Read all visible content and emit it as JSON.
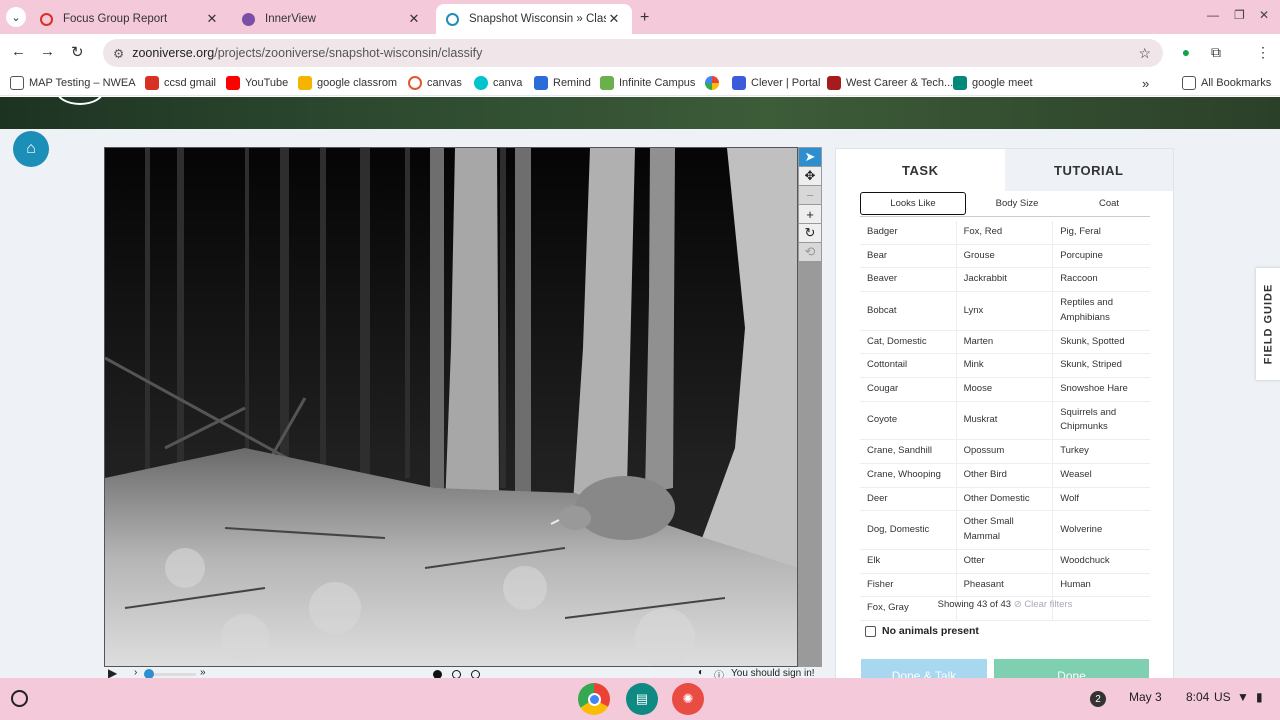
{
  "browser": {
    "tabs": [
      {
        "title": "Focus Group Report",
        "fav_color": "#d93025"
      },
      {
        "title": "InnerView",
        "fav_color": "#7b4fa5"
      },
      {
        "title": "Snapshot Wisconsin » Classify",
        "fav_color": "#1b8fb7"
      }
    ],
    "url_domain": "zooniverse.org",
    "url_path": "/projects/zooniverse/snapshot-wisconsin/classify",
    "bookmarks": [
      {
        "label": "MAP Testing – NWEA",
        "color": "#555555"
      },
      {
        "label": "ccsd gmail",
        "color": "#d93025"
      },
      {
        "label": "YouTube",
        "color": "#ff0000"
      },
      {
        "label": "google classrom",
        "color": "#f4b400"
      },
      {
        "label": "canvas",
        "color": "#e4572e"
      },
      {
        "label": "canva",
        "color": "#00c4cc"
      },
      {
        "label": "Remind",
        "color": "#2b6cd9"
      },
      {
        "label": "Infinite Campus",
        "color": "#6ab04c"
      },
      {
        "label": "",
        "color": "#4285f4"
      },
      {
        "label": "Clever | Portal",
        "color": "#3b5bdb"
      },
      {
        "label": "West Career & Tech...",
        "color": "#a61c1c"
      },
      {
        "label": "google meet",
        "color": "#00897b"
      }
    ],
    "all_bookmarks": "All Bookmarks"
  },
  "viewer": {
    "indicator": "You should sign in!"
  },
  "panel": {
    "tabs": [
      "TASK",
      "TUTORIAL"
    ],
    "filters": [
      "Looks Like",
      "Body Size",
      "Coat"
    ],
    "species_rows": [
      [
        "Badger",
        "Fox, Red",
        "Pig, Feral"
      ],
      [
        "Bear",
        "Grouse",
        "Porcupine"
      ],
      [
        "Beaver",
        "Jackrabbit",
        "Raccoon"
      ],
      [
        "Bobcat",
        "Lynx",
        "Reptiles and Amphibians"
      ],
      [
        "Cat, Domestic",
        "Marten",
        "Skunk, Spotted"
      ],
      [
        "Cottontail",
        "Mink",
        "Skunk, Striped"
      ],
      [
        "Cougar",
        "Moose",
        "Snowshoe Hare"
      ],
      [
        "Coyote",
        "Muskrat",
        "Squirrels and Chipmunks"
      ],
      [
        "Crane, Sandhill",
        "Opossum",
        "Turkey"
      ],
      [
        "Crane, Whooping",
        "Other Bird",
        "Weasel"
      ],
      [
        "Deer",
        "Other Domestic",
        "Wolf"
      ],
      [
        "Dog, Domestic",
        "Other Small Mammal",
        "Wolverine"
      ],
      [
        "Elk",
        "Otter",
        "Woodchuck"
      ],
      [
        "Fisher",
        "Pheasant",
        "Human"
      ],
      [
        "Fox, Gray",
        "",
        ""
      ]
    ],
    "showing": "Showing 43 of 43",
    "clear_filters": "Clear filters",
    "no_animals": "No animals present",
    "done_talk": "Done & Talk",
    "done": "Done"
  },
  "field_guide": "FIELD GUIDE",
  "shelf": {
    "date": "May 3",
    "time": "8:04",
    "region": "US",
    "notifications": "2"
  }
}
